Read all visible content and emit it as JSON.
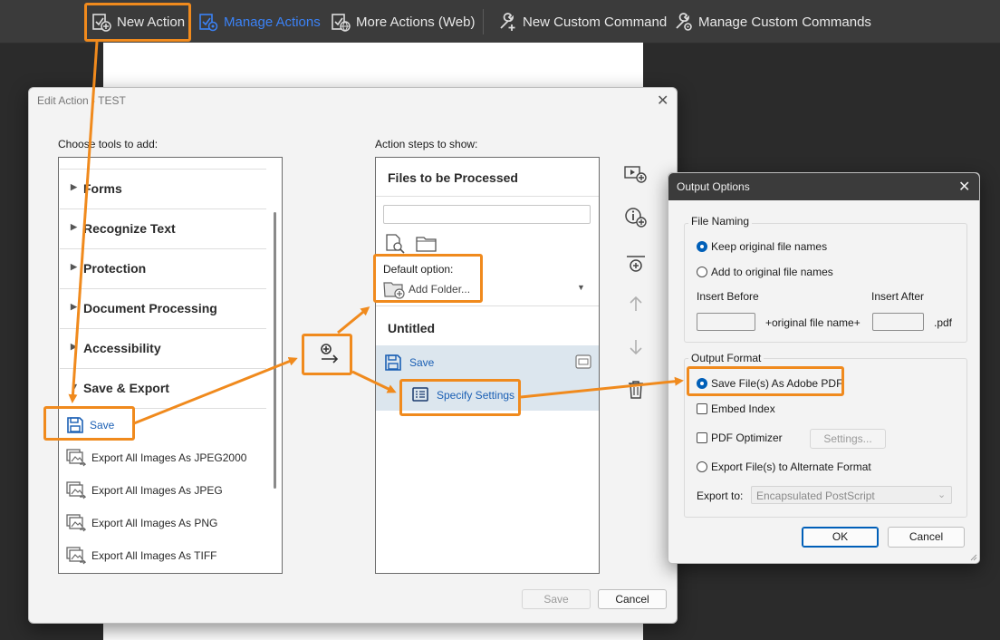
{
  "toolbar": {
    "new_action": "New Action",
    "manage_actions": "Manage Actions",
    "more_actions": "More Actions (Web)",
    "new_custom_command": "New Custom Command",
    "manage_custom_commands": "Manage Custom Commands",
    "active_color": "#3b82f6"
  },
  "edit_dialog": {
    "title": "Edit Action - TEST",
    "close_icon": "close-icon",
    "choose_tools_label": "Choose tools to add:",
    "action_steps_label": "Action steps to show:",
    "sections": [
      {
        "label": "Forms"
      },
      {
        "label": "Recognize Text"
      },
      {
        "label": "Protection"
      },
      {
        "label": "Document Processing"
      },
      {
        "label": "Accessibility"
      },
      {
        "label": "Save & Export"
      }
    ],
    "tools": [
      {
        "label": "Save",
        "icon": "save-icon"
      },
      {
        "label": "Export All Images As JPEG2000",
        "icon": "export-images-icon"
      },
      {
        "label": "Export All Images As JPEG",
        "icon": "export-images-icon"
      },
      {
        "label": "Export All Images As PNG",
        "icon": "export-images-icon"
      },
      {
        "label": "Export All Images As TIFF",
        "icon": "export-images-icon"
      }
    ],
    "files_header": "Files to be Processed",
    "default_option_label": "Default option:",
    "add_folder_label": "Add Folder...",
    "untitled_label": "Untitled",
    "step_save_label": "Save",
    "step_specify_settings": "Specify Settings",
    "save_button": "Save",
    "cancel_button": "Cancel",
    "highlight_color": "#f08a1d"
  },
  "output_dialog": {
    "title": "Output Options",
    "file_naming_title": "File Naming",
    "keep_original": "Keep original file names",
    "add_to_original": "Add to original file names",
    "insert_before": "Insert Before",
    "insert_after": "Insert After",
    "original_file_name": "+original file name+",
    "pdf_ext": ".pdf",
    "output_format_title": "Output Format",
    "save_as_pdf": "Save File(s) As Adobe PDF",
    "embed_index": "Embed Index",
    "pdf_optimizer": "PDF Optimizer",
    "settings_button": "Settings...",
    "export_alternate": "Export File(s) to Alternate Format",
    "export_to_label": "Export to:",
    "export_to_value": "Encapsulated PostScript",
    "ok_button": "OK",
    "cancel_button": "Cancel",
    "selected_naming": "keep_original",
    "selected_format": "save_as_pdf"
  }
}
